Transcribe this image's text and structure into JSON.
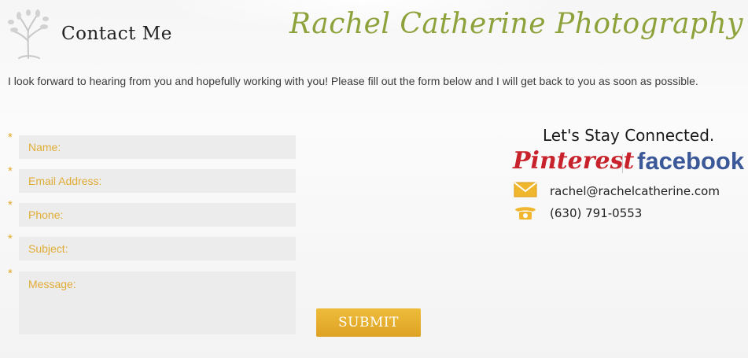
{
  "header": {
    "title": "Contact Me",
    "brand": "Rachel Catherine Photography"
  },
  "intro": "I look forward to hearing from you and hopefully working with you! Please fill out the form below and I will get back to you as soon as possible.",
  "form": {
    "required_marker": "*",
    "name_placeholder": "Name:",
    "email_placeholder": "Email Address:",
    "phone_placeholder": "Phone:",
    "subject_placeholder": "Subject:",
    "message_placeholder": "Message:",
    "submit_label": "SUBMIT"
  },
  "connect": {
    "heading": "Let's Stay Connected.",
    "pinterest": "Pinterest",
    "facebook": "facebook",
    "email": "rachel@rachelcatherine.com",
    "phone": "(630) 791-0553"
  },
  "colors": {
    "accent": "#e0a92a",
    "brand_green": "#8da23b",
    "pinterest_red": "#c8232c",
    "facebook_blue": "#3b5998"
  },
  "icons": [
    "tree-logo-icon",
    "mail-icon",
    "phone-icon"
  ]
}
